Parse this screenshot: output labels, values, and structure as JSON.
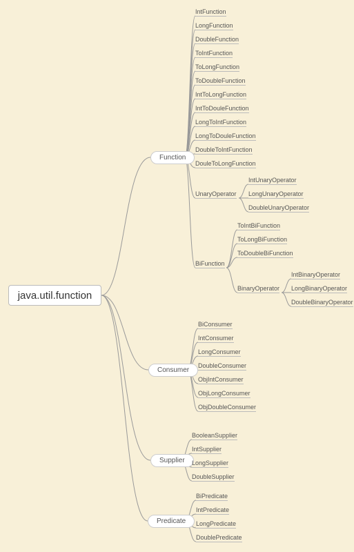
{
  "root": "java.util.function",
  "branches": {
    "function": "Function",
    "consumer": "Consumer",
    "supplier": "Supplier",
    "predicate": "Predicate"
  },
  "sub": {
    "unaryOperator": "UnaryOperator",
    "biFunction": "BiFunction",
    "binaryOperator": "BinaryOperator"
  },
  "leaves": {
    "fn": [
      "IntFunction",
      "LongFunction",
      "DoubleFunction",
      "ToIntFunction",
      "ToLongFunction",
      "ToDoubleFunction",
      "IntToLongFunction",
      "IntToDouleFunction",
      "LongToIntFunction",
      "LongToDouleFunction",
      "DoubleToIntFunction",
      "DouleToLongFunction"
    ],
    "unary": [
      "IntUnaryOperator",
      "LongUnaryOperator",
      "DoubleUnaryOperator"
    ],
    "bifn": [
      "ToIntBiFunction",
      "ToLongBiFunction",
      "ToDoubleBiFunction"
    ],
    "binop": [
      "IntBinaryOperator",
      "LongBinaryOperator",
      "DoubleBinaryOperator"
    ],
    "consumer": [
      "BiConsumer",
      "IntConsumer",
      "LongConsumer",
      "DoubleConsumer",
      "ObjIntConsumer",
      "ObjLongConsumer",
      "ObjDoubleConsumer"
    ],
    "supplier": [
      "BooleanSupplier",
      "IntSupplier",
      "LongSupplier",
      "DoubleSupplier"
    ],
    "predicate": [
      "BiPredicate",
      "IntPredicate",
      "LongPredicate",
      "DoublePredicate"
    ]
  },
  "chart_data": {
    "type": "tree",
    "title": "java.util.function",
    "root": "java.util.function",
    "children": [
      {
        "name": "Function",
        "children": [
          {
            "name": "IntFunction"
          },
          {
            "name": "LongFunction"
          },
          {
            "name": "DoubleFunction"
          },
          {
            "name": "ToIntFunction"
          },
          {
            "name": "ToLongFunction"
          },
          {
            "name": "ToDoubleFunction"
          },
          {
            "name": "IntToLongFunction"
          },
          {
            "name": "IntToDouleFunction"
          },
          {
            "name": "LongToIntFunction"
          },
          {
            "name": "LongToDouleFunction"
          },
          {
            "name": "DoubleToIntFunction"
          },
          {
            "name": "DouleToLongFunction"
          },
          {
            "name": "UnaryOperator",
            "children": [
              {
                "name": "IntUnaryOperator"
              },
              {
                "name": "LongUnaryOperator"
              },
              {
                "name": "DoubleUnaryOperator"
              }
            ]
          },
          {
            "name": "BiFunction",
            "children": [
              {
                "name": "ToIntBiFunction"
              },
              {
                "name": "ToLongBiFunction"
              },
              {
                "name": "ToDoubleBiFunction"
              },
              {
                "name": "BinaryOperator",
                "children": [
                  {
                    "name": "IntBinaryOperator"
                  },
                  {
                    "name": "LongBinaryOperator"
                  },
                  {
                    "name": "DoubleBinaryOperator"
                  }
                ]
              }
            ]
          }
        ]
      },
      {
        "name": "Consumer",
        "children": [
          {
            "name": "BiConsumer"
          },
          {
            "name": "IntConsumer"
          },
          {
            "name": "LongConsumer"
          },
          {
            "name": "DoubleConsumer"
          },
          {
            "name": "ObjIntConsumer"
          },
          {
            "name": "ObjLongConsumer"
          },
          {
            "name": "ObjDoubleConsumer"
          }
        ]
      },
      {
        "name": "Supplier",
        "children": [
          {
            "name": "BooleanSupplier"
          },
          {
            "name": "IntSupplier"
          },
          {
            "name": "LongSupplier"
          },
          {
            "name": "DoubleSupplier"
          }
        ]
      },
      {
        "name": "Predicate",
        "children": [
          {
            "name": "BiPredicate"
          },
          {
            "name": "IntPredicate"
          },
          {
            "name": "LongPredicate"
          },
          {
            "name": "DoublePredicate"
          }
        ]
      }
    ]
  }
}
